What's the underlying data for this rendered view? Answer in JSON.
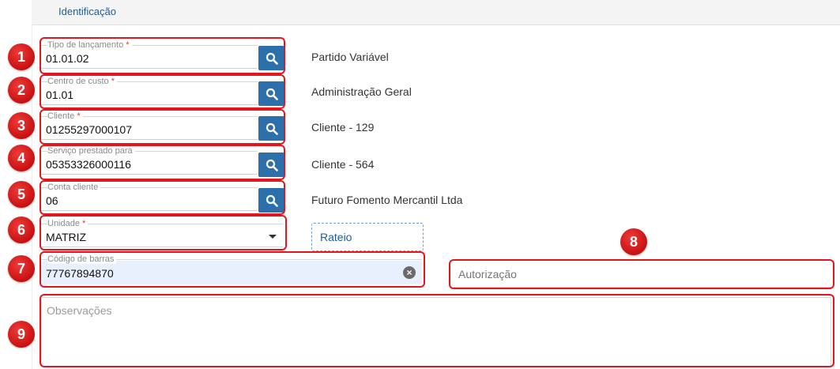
{
  "header": {
    "tab_label": "Identificação"
  },
  "fields": [
    {
      "label": "Tipo de lançamento",
      "required": "*",
      "value": "01.01.02",
      "description": "Partido Variável",
      "badge": "1"
    },
    {
      "label": "Centro de custo",
      "required": "*",
      "value": "01.01",
      "description": "Administração Geral",
      "badge": "2"
    },
    {
      "label": "Cliente",
      "required": "*",
      "value": "01255297000107",
      "description": "Cliente - 129",
      "badge": "3"
    },
    {
      "label": "Serviço prestado para",
      "required": "",
      "value": "05353326000116",
      "description": "Cliente - 564",
      "badge": "4"
    },
    {
      "label": "Conta cliente",
      "required": "",
      "value": "06",
      "description": "Futuro Fomento Mercantil Ltda",
      "badge": "5"
    }
  ],
  "unidade": {
    "label": "Unidade",
    "required": "*",
    "value": "MATRIZ",
    "badge": "6"
  },
  "rateio": {
    "label": "Rateio"
  },
  "barcode": {
    "label": "Código de barras",
    "value": "77767894870",
    "badge": "7"
  },
  "autorizacao": {
    "placeholder": "Autorização",
    "badge": "8"
  },
  "observacoes": {
    "placeholder": "Observações",
    "badge": "9"
  },
  "colors": {
    "accent": "#2c6faa",
    "annotation": "#e4161b",
    "autofill": "#e8f0fe"
  }
}
